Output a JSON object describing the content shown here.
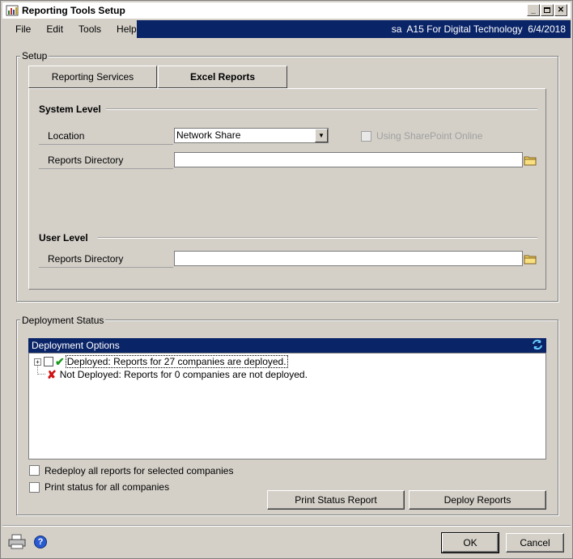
{
  "window": {
    "title": "Reporting Tools Setup"
  },
  "menu": {
    "items": [
      "File",
      "Edit",
      "Tools",
      "Help"
    ],
    "context": "sa  A15 For Digital Technology  6/4/2018"
  },
  "setup": {
    "group_label": "Setup",
    "tabs": [
      {
        "label": "Reporting Services"
      },
      {
        "label": "Excel Reports"
      }
    ],
    "system_level": {
      "header": "System Level",
      "location_label": "Location",
      "location_value": "Network Share",
      "sharepoint_label": "Using SharePoint Online",
      "reports_dir_label": "Reports Directory",
      "reports_dir_value": ""
    },
    "user_level": {
      "header": "User Level",
      "reports_dir_label": "Reports Directory",
      "reports_dir_value": ""
    }
  },
  "deployment": {
    "group_label": "Deployment Status",
    "list_header": "Deployment Options",
    "tree": [
      {
        "text": "Deployed: Reports for 27 companies are deployed."
      },
      {
        "text": "Not Deployed: Reports for 0 companies are not deployed."
      }
    ],
    "options": [
      {
        "label": "Redeploy all reports for selected companies"
      },
      {
        "label": "Print status for all companies"
      }
    ],
    "buttons": {
      "print_status": "Print Status Report",
      "deploy": "Deploy Reports"
    }
  },
  "footer": {
    "ok": "OK",
    "cancel": "Cancel"
  },
  "colors": {
    "accent": "#0a2468",
    "face": "#d4d0c8"
  }
}
